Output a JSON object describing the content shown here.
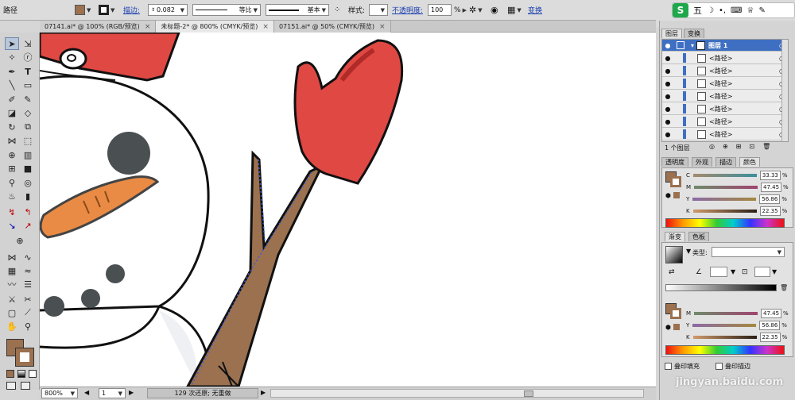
{
  "control_bar": {
    "object_type": "路径",
    "stroke_label": "描边:",
    "stroke_value": "0.082",
    "profile_label": "等比",
    "brush_label": "基本",
    "style_label": "样式:",
    "opacity_label": "不透明度:",
    "opacity_value": "100",
    "opacity_unit": "%",
    "transform_link": "变换",
    "fill_color": "#9b7150",
    "stroke_color": "#9b7150"
  },
  "tabs": [
    {
      "label": "07141.ai* @ 100% (RGB/预览)",
      "close": "×"
    },
    {
      "label": "未标题-2* @ 800% (CMYK/预览)",
      "close": "×"
    },
    {
      "label": "07151.ai* @ 50% (CMYK/预览)",
      "close": "×"
    }
  ],
  "sogou_bar": {
    "items": [
      "五",
      "☽",
      "•,",
      "⌨",
      "♕",
      "✎"
    ]
  },
  "status_bar": {
    "zoom": "800%",
    "page": "1",
    "message": "129 次还原; 无重做"
  },
  "layers_panel": {
    "tabs": [
      "图层",
      "变换"
    ],
    "layer_name": "图层 1",
    "paths": [
      "<路径>",
      "<路径>",
      "<路径>",
      "<路径>",
      "<路径>",
      "<路径>",
      "<路径>"
    ],
    "footer_count": "1 个图层"
  },
  "color_panel": {
    "tabs": [
      "透明度",
      "外观",
      "描边",
      "颜色"
    ],
    "channels": [
      {
        "label": "C",
        "value": "33.33"
      },
      {
        "label": "M",
        "value": "47.45"
      },
      {
        "label": "Y",
        "value": "56.86"
      },
      {
        "label": "K",
        "value": "22.35"
      }
    ],
    "unit": "%"
  },
  "gradient_panel": {
    "tabs": [
      "渐变",
      "色板"
    ],
    "type_label": "类型:",
    "channels": [
      {
        "label": "M",
        "value": "47.45"
      },
      {
        "label": "Y",
        "value": "56.86"
      },
      {
        "label": "K",
        "value": "22.35"
      }
    ],
    "unit": "%"
  },
  "attributes_panel": {
    "overprint_fill": "叠印填充",
    "overprint_stroke": "叠印描边"
  },
  "watermark": "jingyan.baidu.com"
}
